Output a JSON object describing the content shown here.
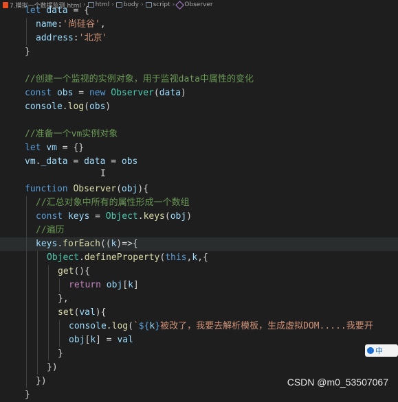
{
  "breadcrumb": {
    "file": "7.模拟一个数据监测.html",
    "items": [
      "html",
      "body",
      "script",
      "Observer"
    ]
  },
  "code_lines": [
    {
      "indent": 0,
      "tokens": [
        [
          "kw",
          "let"
        ],
        [
          "txt",
          " "
        ],
        [
          "var",
          "data"
        ],
        [
          "txt",
          " = {"
        ]
      ]
    },
    {
      "indent": 1,
      "tokens": [
        [
          "var",
          "name"
        ],
        [
          "txt",
          ":"
        ],
        [
          "str",
          "'尚硅谷'"
        ],
        [
          "txt",
          ","
        ]
      ]
    },
    {
      "indent": 1,
      "tokens": [
        [
          "var",
          "address"
        ],
        [
          "txt",
          ":"
        ],
        [
          "str",
          "'北京'"
        ]
      ]
    },
    {
      "indent": 0,
      "tokens": [
        [
          "txt",
          "}"
        ]
      ]
    },
    {
      "indent": 0,
      "tokens": []
    },
    {
      "indent": 0,
      "tokens": [
        [
          "cmt",
          "//创建一个监视的实例对象，用于监视data中属性的变化"
        ]
      ]
    },
    {
      "indent": 0,
      "tokens": [
        [
          "kw",
          "const"
        ],
        [
          "txt",
          " "
        ],
        [
          "var",
          "obs"
        ],
        [
          "txt",
          " = "
        ],
        [
          "kw",
          "new"
        ],
        [
          "txt",
          " "
        ],
        [
          "cls",
          "Observer"
        ],
        [
          "txt",
          "("
        ],
        [
          "var",
          "data"
        ],
        [
          "txt",
          ")"
        ]
      ]
    },
    {
      "indent": 0,
      "tokens": [
        [
          "var",
          "console"
        ],
        [
          "txt",
          "."
        ],
        [
          "fn",
          "log"
        ],
        [
          "txt",
          "("
        ],
        [
          "var",
          "obs"
        ],
        [
          "txt",
          ")"
        ]
      ]
    },
    {
      "indent": 0,
      "tokens": []
    },
    {
      "indent": 0,
      "tokens": [
        [
          "cmt",
          "//准备一个vm实例对象"
        ]
      ]
    },
    {
      "indent": 0,
      "tokens": [
        [
          "kw",
          "let"
        ],
        [
          "txt",
          " "
        ],
        [
          "var",
          "vm"
        ],
        [
          "txt",
          " = {}"
        ]
      ]
    },
    {
      "indent": 0,
      "tokens": [
        [
          "var",
          "vm"
        ],
        [
          "txt",
          "."
        ],
        [
          "var",
          "_data"
        ],
        [
          "txt",
          " = "
        ],
        [
          "var",
          "data"
        ],
        [
          "txt",
          " = "
        ],
        [
          "var",
          "obs"
        ]
      ]
    },
    {
      "indent": 0,
      "tokens": []
    },
    {
      "indent": 0,
      "tokens": [
        [
          "kw",
          "function"
        ],
        [
          "txt",
          " "
        ],
        [
          "fn",
          "Observer"
        ],
        [
          "txt",
          "("
        ],
        [
          "var",
          "obj"
        ],
        [
          "txt",
          "){"
        ]
      ]
    },
    {
      "indent": 1,
      "tokens": [
        [
          "cmt",
          "//汇总对象中所有的属性形成一个数组"
        ]
      ]
    },
    {
      "indent": 1,
      "tokens": [
        [
          "kw",
          "const"
        ],
        [
          "txt",
          " "
        ],
        [
          "var",
          "keys"
        ],
        [
          "txt",
          " = "
        ],
        [
          "cls",
          "Object"
        ],
        [
          "txt",
          "."
        ],
        [
          "fn",
          "keys"
        ],
        [
          "txt",
          "("
        ],
        [
          "var",
          "obj"
        ],
        [
          "txt",
          ")"
        ]
      ]
    },
    {
      "indent": 1,
      "tokens": [
        [
          "cmt",
          "//遍历"
        ]
      ]
    },
    {
      "indent": 1,
      "hl": true,
      "tokens": [
        [
          "var",
          "keys"
        ],
        [
          "txt",
          "."
        ],
        [
          "fn",
          "forEach"
        ],
        [
          "txt",
          "(("
        ],
        [
          "var",
          "k"
        ],
        [
          "txt",
          ")=>{"
        ]
      ]
    },
    {
      "indent": 2,
      "tokens": [
        [
          "cls",
          "Object"
        ],
        [
          "txt",
          "."
        ],
        [
          "fn",
          "defineProperty"
        ],
        [
          "txt",
          "("
        ],
        [
          "kw",
          "this"
        ],
        [
          "txt",
          ","
        ],
        [
          "var",
          "k"
        ],
        [
          "txt",
          ",{"
        ]
      ]
    },
    {
      "indent": 3,
      "tokens": [
        [
          "fn",
          "get"
        ],
        [
          "txt",
          "(){"
        ]
      ]
    },
    {
      "indent": 4,
      "tokens": [
        [
          "ctl",
          "return"
        ],
        [
          "txt",
          " "
        ],
        [
          "var",
          "obj"
        ],
        [
          "txt",
          "["
        ],
        [
          "var",
          "k"
        ],
        [
          "txt",
          "]"
        ]
      ]
    },
    {
      "indent": 3,
      "tokens": [
        [
          "txt",
          "},"
        ]
      ]
    },
    {
      "indent": 3,
      "tokens": [
        [
          "fn",
          "set"
        ],
        [
          "txt",
          "("
        ],
        [
          "var",
          "val"
        ],
        [
          "txt",
          "){"
        ]
      ]
    },
    {
      "indent": 4,
      "tokens": [
        [
          "var",
          "console"
        ],
        [
          "txt",
          "."
        ],
        [
          "fn",
          "log"
        ],
        [
          "txt",
          "("
        ],
        [
          "tpl",
          "`"
        ],
        [
          "kw",
          "${"
        ],
        [
          "var",
          "k"
        ],
        [
          "kw",
          "}"
        ],
        [
          "tpl",
          "被改了，我要去解析模板，生成虚拟DOM.....我要开"
        ]
      ]
    },
    {
      "indent": 4,
      "tokens": [
        [
          "var",
          "obj"
        ],
        [
          "txt",
          "["
        ],
        [
          "var",
          "k"
        ],
        [
          "txt",
          "] = "
        ],
        [
          "var",
          "val"
        ]
      ]
    },
    {
      "indent": 3,
      "tokens": [
        [
          "txt",
          "}"
        ]
      ]
    },
    {
      "indent": 2,
      "tokens": [
        [
          "txt",
          "})"
        ]
      ]
    },
    {
      "indent": 1,
      "tokens": [
        [
          "txt",
          "})"
        ]
      ]
    },
    {
      "indent": 0,
      "tokens": [
        [
          "txt",
          "}"
        ]
      ]
    }
  ],
  "ime": {
    "label": "中"
  },
  "watermark": "CSDN @m0_53507067",
  "cursor_glyph": "I"
}
